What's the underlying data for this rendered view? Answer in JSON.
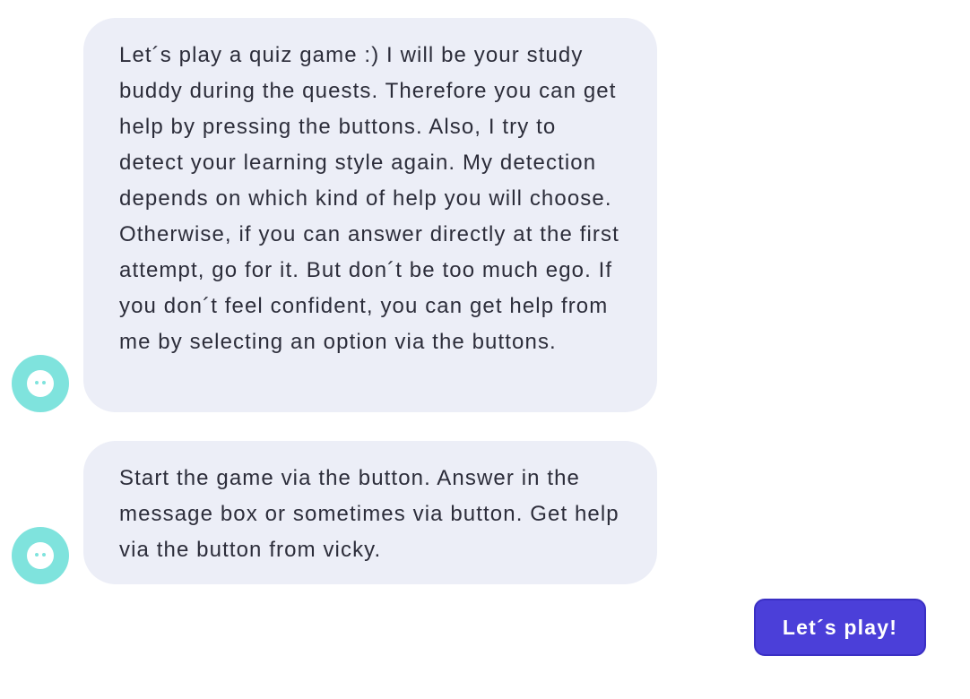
{
  "messages": [
    {
      "sender_icon": "bot-face-icon",
      "text": "Let´s play a quiz game :) I will be your study buddy during the quests. Therefore you can get help by pressing the buttons. Also, I try to detect your learning style again. My detection depends on which kind of help you will choose. Otherwise, if you can answer directly at the first attempt, go for it. But don´t be too much ego. If you don´t feel confident, you can get help from me by selecting an option via the buttons."
    },
    {
      "sender_icon": "bot-face-icon",
      "text": "Start the game via the button. Answer in the message box or sometimes via button. Get help via the button from vicky."
    }
  ],
  "actions": {
    "play_label": "Let´s play!"
  },
  "colors": {
    "bubble_bg": "#eceef7",
    "avatar_bg": "#7fe3dd",
    "button_bg": "#4b3fd9",
    "text": "#2c2d3a"
  }
}
